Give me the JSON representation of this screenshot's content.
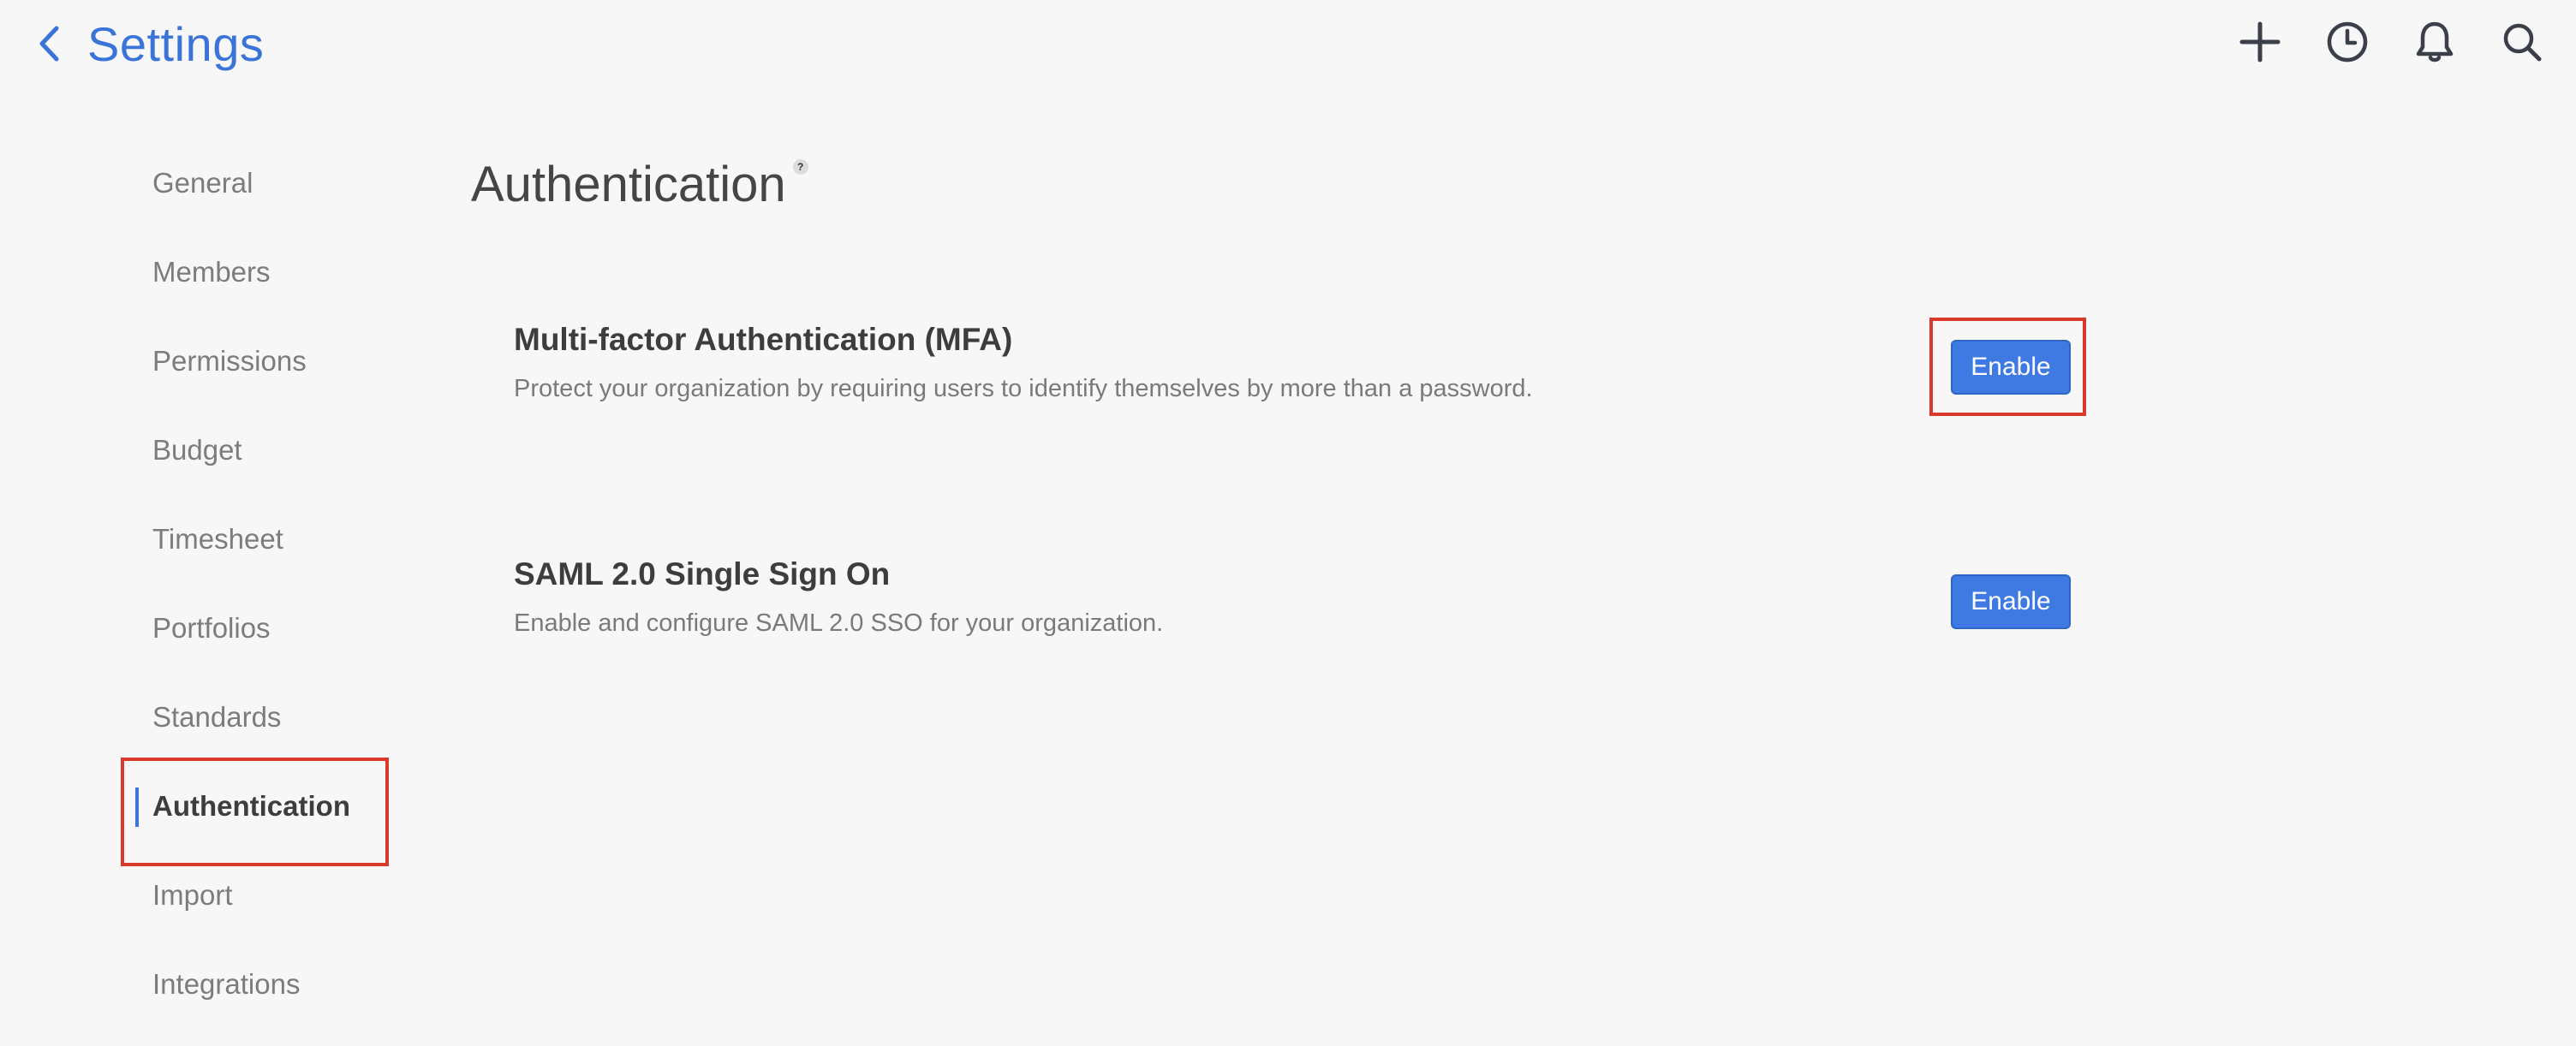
{
  "header": {
    "title": "Settings",
    "back_icon": "chevron-left-icon",
    "actions": [
      {
        "name": "add-button",
        "icon": "plus-icon"
      },
      {
        "name": "history-button",
        "icon": "clock-icon"
      },
      {
        "name": "notifications-button",
        "icon": "bell-icon"
      },
      {
        "name": "search-button",
        "icon": "search-icon"
      }
    ]
  },
  "sidebar": {
    "items": [
      {
        "label": "General",
        "active": false
      },
      {
        "label": "Members",
        "active": false
      },
      {
        "label": "Permissions",
        "active": false
      },
      {
        "label": "Budget",
        "active": false
      },
      {
        "label": "Timesheet",
        "active": false
      },
      {
        "label": "Portfolios",
        "active": false
      },
      {
        "label": "Standards",
        "active": false
      },
      {
        "label": "Authentication",
        "active": true
      },
      {
        "label": "Import",
        "active": false
      },
      {
        "label": "Integrations",
        "active": false
      }
    ]
  },
  "main": {
    "title": "Authentication",
    "help_glyph": "?",
    "sections": [
      {
        "title": "Multi-factor Authentication (MFA)",
        "description": "Protect your organization by requiring users to identify themselves by more than a password.",
        "button_label": "Enable"
      },
      {
        "title": "SAML 2.0 Single Sign On",
        "description": "Enable and configure SAML 2.0 SSO for your organization.",
        "button_label": "Enable"
      }
    ]
  },
  "colors": {
    "accent": "#3b74d9",
    "button": "#3f7ae3",
    "highlight": "#d8392a",
    "background": "#f7f7f7"
  }
}
